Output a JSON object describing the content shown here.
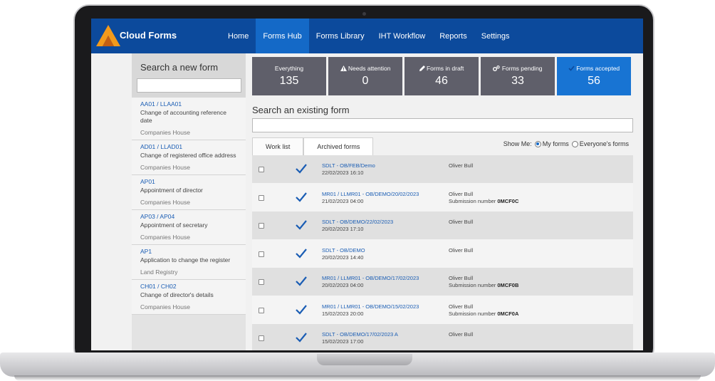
{
  "nav": {
    "brand": "Cloud Forms",
    "items": [
      {
        "label": "Home",
        "active": false
      },
      {
        "label": "Forms Hub",
        "active": true
      },
      {
        "label": "Forms Library",
        "active": false
      },
      {
        "label": "IHT Workflow",
        "active": false
      },
      {
        "label": "Reports",
        "active": false
      },
      {
        "label": "Settings",
        "active": false
      }
    ]
  },
  "left_panel": {
    "title": "Search a new form",
    "search_value": "",
    "forms": [
      {
        "code": "AA01 / LLAA01",
        "name": "Change of accounting reference date",
        "source": "Companies House"
      },
      {
        "code": "AD01 / LLAD01",
        "name": "Change of registered office address",
        "source": "Companies House"
      },
      {
        "code": "AP01",
        "name": "Appointment of director",
        "source": "Companies House"
      },
      {
        "code": "AP03 / AP04",
        "name": "Appointment of secretary",
        "source": "Companies House"
      },
      {
        "code": "AP1",
        "name": "Application to change the register",
        "source": "Land Registry"
      },
      {
        "code": "CH01 / CH02",
        "name": "Change of director's details",
        "source": "Companies House"
      }
    ]
  },
  "tiles": [
    {
      "label": "Everything",
      "count": "135",
      "icon": "",
      "active": false
    },
    {
      "label": "Needs attention",
      "count": "0",
      "icon": "warning-icon",
      "active": false
    },
    {
      "label": "Forms in draft",
      "count": "46",
      "icon": "pen-icon",
      "active": false
    },
    {
      "label": "Forms pending",
      "count": "33",
      "icon": "gears-icon",
      "active": false
    },
    {
      "label": "Forms accepted",
      "count": "56",
      "icon": "check-icon",
      "active": true
    }
  ],
  "existing": {
    "title": "Search an existing form",
    "search_value": ""
  },
  "tabs": [
    {
      "label": "Work list",
      "active": true
    },
    {
      "label": "Archived forms",
      "active": false
    }
  ],
  "show_me": {
    "label": "Show Me:",
    "options": [
      {
        "label": "My forms",
        "selected": true
      },
      {
        "label": "Everyone's forms",
        "selected": false
      }
    ]
  },
  "rows": [
    {
      "ref": "SDLT - OB/FEB/Demo",
      "date": "22/02/2023 16:10",
      "owner": "Oliver Bull",
      "submission_label": "",
      "submission_no": ""
    },
    {
      "ref": "MR01 / LLMR01 - OB/DEMO/20/02/2023",
      "date": "21/02/2023 04:00",
      "owner": "Oliver Bull",
      "submission_label": "Submission number",
      "submission_no": "0MCF0C"
    },
    {
      "ref": "SDLT - OB/DEMO/22/02/2023",
      "date": "20/02/2023 17:10",
      "owner": "Oliver Bull",
      "submission_label": "",
      "submission_no": ""
    },
    {
      "ref": "SDLT - OB/DEMO",
      "date": "20/02/2023 14:40",
      "owner": "Oliver Bull",
      "submission_label": "",
      "submission_no": ""
    },
    {
      "ref": "MR01 / LLMR01 - OB/DEMO/17/02/2023",
      "date": "20/02/2023 04:00",
      "owner": "Oliver Bull",
      "submission_label": "Submission number",
      "submission_no": "0MCF0B"
    },
    {
      "ref": "MR01 / LLMR01 - OB/DEMO/15/02/2023",
      "date": "15/02/2023 20:00",
      "owner": "Oliver Bull",
      "submission_label": "Submission number",
      "submission_no": "0MCF0A"
    },
    {
      "ref": "SDLT - OB/DEMO/17/02/2023 A",
      "date": "15/02/2023 17:00",
      "owner": "Oliver Bull",
      "submission_label": "",
      "submission_no": ""
    }
  ],
  "colors": {
    "nav": "#0c4a9c",
    "nav_active": "#1469c7",
    "tile": "#5f5f6a",
    "tile_active": "#1874d3",
    "link": "#1a5db4",
    "logo_orange": "#f39a1b"
  }
}
